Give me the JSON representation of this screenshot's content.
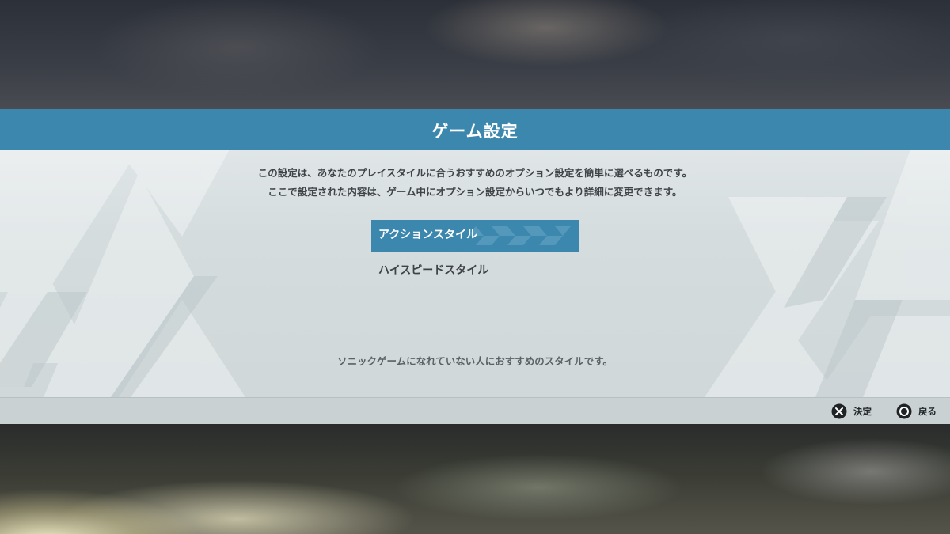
{
  "screen": {
    "title": "ゲーム設定"
  },
  "description": {
    "line1": "この設定は、あなたのプレイスタイルに合うおすすめのオプション設定を簡単に選べるものです。",
    "line2": "ここで設定された内容は、ゲーム中にオプション設定からいつでもより詳細に変更できます。"
  },
  "menu": {
    "items": [
      {
        "label": "アクションスタイル",
        "selected": true
      },
      {
        "label": "ハイスピードスタイル",
        "selected": false
      }
    ]
  },
  "hint": {
    "text": "ソニックゲームになれていない人におすすめのスタイルです。"
  },
  "footer": {
    "confirm": {
      "icon": "cross-button-icon",
      "label": "決定"
    },
    "back": {
      "icon": "circle-button-icon",
      "label": "戻る"
    }
  },
  "colors": {
    "accent": "#3b87ad",
    "panel": "#d9e0e2",
    "footer": "#c9d1d2",
    "text_dark": "#3f4448"
  }
}
